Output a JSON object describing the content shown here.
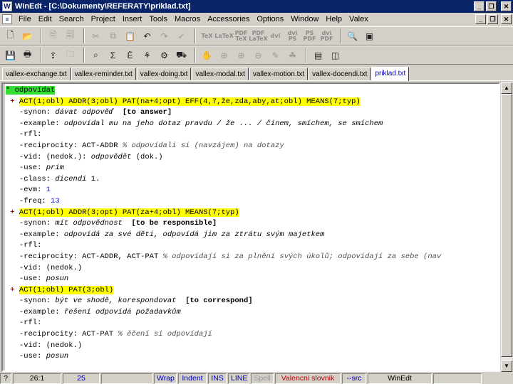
{
  "window": {
    "title": "WinEdt - [C:\\Dokumenty\\REFERATY\\priklad.txt]",
    "app_icon": "winedt-logo-icon",
    "buttons": [
      "minimize-icon",
      "restore-icon",
      "close-icon"
    ]
  },
  "menu": {
    "items": [
      "File",
      "Edit",
      "Search",
      "Project",
      "Insert",
      "Tools",
      "Macros",
      "Accessories",
      "Options",
      "Window",
      "Help",
      "Valex"
    ]
  },
  "toolbar1": {
    "icons": [
      "new-file-icon",
      "open-folder-icon",
      "open-doc-icon",
      "close-doc-icon",
      "cut-icon",
      "copy-icon",
      "paste-icon",
      "undo-icon",
      "redo-icon",
      "spellcheck-icon",
      "tex-icon",
      "latex-icon",
      "pdftex-icon",
      "pdflatex-icon",
      "dvi-icon",
      "dvips-icon",
      "ps2pdf-icon",
      "dvipdf-icon",
      "preview-icon",
      "console-icon"
    ],
    "labels": {
      "tex": "TeX",
      "latex": "LaTeX",
      "pdftex": "PDF TeX",
      "pdflatex": "PDF LaTeX",
      "dvi": "dvi",
      "dvips": "dvi PS",
      "ps2pdf": "PS PDF",
      "dvipdf": "dvi PDF"
    }
  },
  "toolbar2": {
    "icons": [
      "save-icon",
      "print-icon",
      "save-all-icon",
      "folder-tree-icon",
      "find-icon",
      "sigma-icon",
      "umlaut-icon",
      "tree-icon",
      "macro-icon",
      "car-icon",
      "hand-icon",
      "zoom-icon",
      "zoom-in-icon",
      "zoom-out-icon",
      "pen-icon",
      "bug-icon",
      "terminal-icon",
      "window-icon"
    ]
  },
  "tabs": [
    {
      "label": "vallex-exchange.txt",
      "active": false
    },
    {
      "label": "vallex-reminder.txt",
      "active": false
    },
    {
      "label": "vallex-doing.txt",
      "active": false
    },
    {
      "label": "vallex-modal.txt",
      "active": false
    },
    {
      "label": "vallex-motion.txt",
      "active": false
    },
    {
      "label": "vallex-docendi.txt",
      "active": false
    },
    {
      "label": "priklad.txt",
      "active": true
    }
  ],
  "editor": {
    "lines": [
      {
        "parts": [
          {
            "t": "* odpovídat",
            "c": "hlg"
          }
        ]
      },
      {
        "parts": [
          {
            "t": " + ",
            "c": "mark"
          },
          {
            "t": "ACT(1;obl) ADDR(3;obl) PAT(na+4;opt) EFF(4,7,že,zda,aby,at;obl) MEANS(7;typ)",
            "c": "hl"
          }
        ]
      },
      {
        "parts": [
          {
            "t": "   -synon: "
          },
          {
            "t": "dávat odpověď",
            "c": "it"
          },
          {
            "t": "  "
          },
          {
            "t": "[to answer]",
            "c": "bd"
          }
        ]
      },
      {
        "parts": [
          {
            "t": "   -example: "
          },
          {
            "t": "odpovídal mu na jeho dotaz pravdu / že ... / činem, smíchem, se smíchem",
            "c": "it"
          }
        ]
      },
      {
        "parts": [
          {
            "t": "   -rfl:"
          }
        ]
      },
      {
        "parts": [
          {
            "t": "   -reciprocity: "
          },
          {
            "t": "ACT-ADDR"
          },
          {
            "t": " % odpovídali si (navzájem) na dotazy",
            "c": "cm"
          }
        ]
      },
      {
        "parts": [
          {
            "t": "   -vid: "
          },
          {
            "t": "(nedok.): "
          },
          {
            "t": "odpovědět",
            "c": "it"
          },
          {
            "t": " (dok.)"
          }
        ]
      },
      {
        "parts": [
          {
            "t": "   -use: "
          },
          {
            "t": "prim",
            "c": "it"
          }
        ]
      },
      {
        "parts": [
          {
            "t": "   -class: "
          },
          {
            "t": "dicendi",
            "c": "it"
          },
          {
            "t": " 1."
          }
        ]
      },
      {
        "parts": [
          {
            "t": "   -evm: "
          },
          {
            "t": "1",
            "c": "num"
          }
        ]
      },
      {
        "parts": [
          {
            "t": "   -freq: "
          },
          {
            "t": "13",
            "c": "num"
          }
        ]
      },
      {
        "parts": [
          {
            "t": " + ",
            "c": "mark"
          },
          {
            "t": "ACT(1;obl) ADDR(3;opt) PAT(za+4;obl) MEANS(7;typ)",
            "c": "hl"
          }
        ]
      },
      {
        "parts": [
          {
            "t": "   -synon: "
          },
          {
            "t": "mít odpovědnost",
            "c": "it"
          },
          {
            "t": "  "
          },
          {
            "t": "[to be responsible]",
            "c": "bd"
          }
        ]
      },
      {
        "parts": [
          {
            "t": "   -example: "
          },
          {
            "t": "odpovídá za své děti, odpovídá jim za ztrátu svým majetkem",
            "c": "it"
          }
        ]
      },
      {
        "parts": [
          {
            "t": "   -rfl:"
          }
        ]
      },
      {
        "parts": [
          {
            "t": "   -reciprocity: "
          },
          {
            "t": "ACT-ADDR"
          },
          {
            "t": ", "
          },
          {
            "t": "ACT-PAT"
          },
          {
            "t": " % odpovídají si za plnění svých úkolů; odpovídají za sebe (nav",
            "c": "cm"
          }
        ]
      },
      {
        "parts": [
          {
            "t": "   -vid: "
          },
          {
            "t": "(nedok.)"
          }
        ]
      },
      {
        "parts": [
          {
            "t": "   -use: "
          },
          {
            "t": "posun",
            "c": "it"
          }
        ]
      },
      {
        "parts": [
          {
            "t": " + ",
            "c": "mark"
          },
          {
            "t": "ACT(1;obl) PAT(3;obl)",
            "c": "hl"
          }
        ]
      },
      {
        "parts": [
          {
            "t": "   -synon: "
          },
          {
            "t": "být ve shodě, korespondovat",
            "c": "it"
          },
          {
            "t": "  "
          },
          {
            "t": "[to correspond]",
            "c": "bd"
          }
        ]
      },
      {
        "parts": [
          {
            "t": "   -example: "
          },
          {
            "t": "řešení odpovídá požadavkům",
            "c": "it"
          }
        ]
      },
      {
        "parts": [
          {
            "t": "   -rfl:"
          }
        ]
      },
      {
        "parts": [
          {
            "t": "   -reciprocity: "
          },
          {
            "t": "ACT-PAT"
          },
          {
            "t": " % ěčení si odpovídají",
            "c": "cm"
          }
        ]
      },
      {
        "parts": [
          {
            "t": "   -vid: "
          },
          {
            "t": "(nedok.)"
          }
        ]
      },
      {
        "parts": [
          {
            "t": "   -use: "
          },
          {
            "t": "posun",
            "c": "it"
          }
        ]
      }
    ]
  },
  "statusbar": {
    "help": "?",
    "position": "26:1",
    "lines": "25",
    "wrap": "Wrap",
    "indent": "Indent",
    "ins": "INS",
    "line": "LINE",
    "spell": "Spell",
    "mode": "Valencni slovnik",
    "src": "--src",
    "app": "WinEdt"
  },
  "colors": {
    "title_bg": "#0a246a",
    "highlight_yellow": "#ffff00",
    "highlight_green": "#33dd33",
    "active_tab_text": "#0000c0"
  }
}
